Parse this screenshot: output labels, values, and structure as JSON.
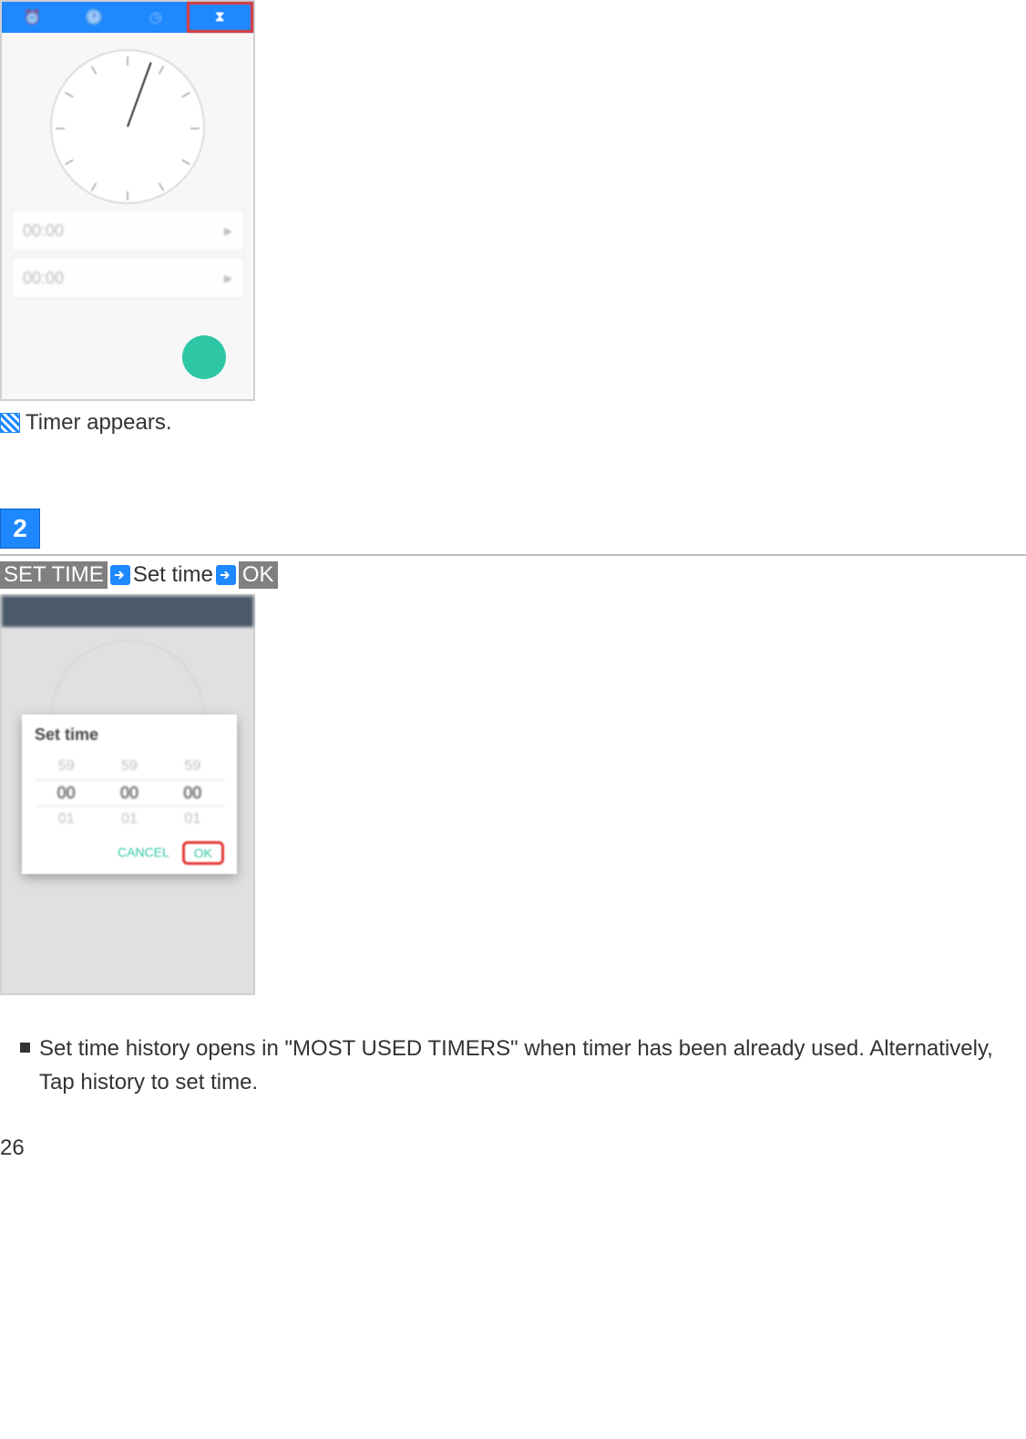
{
  "screenshot1": {
    "tabs": [
      "⏰",
      "🕐",
      "◷",
      "⧗"
    ],
    "timer_rows": [
      "00:00",
      "00:00"
    ]
  },
  "result_line": "Timer appears.",
  "step_number": "2",
  "instruction": {
    "part1": "SET TIME",
    "part2": "Set time",
    "part3": "OK"
  },
  "screenshot2": {
    "dialog_title": "Set time",
    "picker": {
      "above": [
        "59",
        "59",
        "59"
      ],
      "selected": [
        "00",
        "00",
        "00"
      ],
      "below": [
        "01",
        "01",
        "01"
      ]
    },
    "actions": {
      "cancel": "CANCEL",
      "ok": "OK"
    }
  },
  "bullet_text": "Set time history opens in \"MOST USED TIMERS\" when timer has been already used. Alternatively, Tap history to set time.",
  "page_number": "26"
}
